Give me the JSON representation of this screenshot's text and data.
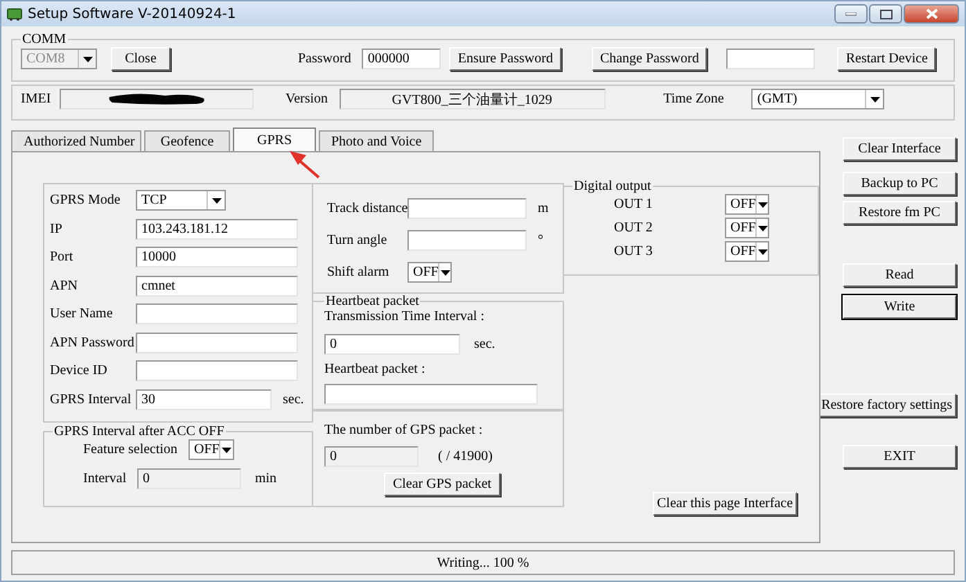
{
  "window": {
    "title": "Setup Software V-20140924-1"
  },
  "comm": {
    "title": "COMM",
    "port": {
      "value": "COM8",
      "disabled": true
    },
    "close": "Close",
    "password": {
      "label": "Password",
      "value": "000000"
    },
    "ensure": "Ensure Password",
    "change": "Change Password",
    "restart": "Restart Device"
  },
  "device": {
    "imei_label": "IMEI",
    "version_label": "Version",
    "version": "GVT800_三个油量计_1029",
    "timezone_label": "Time Zone",
    "timezone": "(GMT)"
  },
  "tabs": [
    {
      "label": "Authorized Number",
      "selected": false
    },
    {
      "label": "Geofence",
      "selected": false
    },
    {
      "label": "GPRS",
      "selected": true
    },
    {
      "label": "Photo and Voice",
      "selected": false
    }
  ],
  "gprs_fields": [
    {
      "label": "GPRS Mode",
      "kind": "combo",
      "value": "TCP"
    },
    {
      "label": "IP",
      "kind": "text",
      "value": "103.243.181.12"
    },
    {
      "label": "Port",
      "kind": "text",
      "value": "10000"
    },
    {
      "label": "APN",
      "kind": "text",
      "value": "cmnet"
    },
    {
      "label": "User Name",
      "kind": "text"
    },
    {
      "label": "APN Password",
      "kind": "text"
    },
    {
      "label": "Device ID",
      "kind": "text"
    },
    {
      "label": "GPRS Interval",
      "kind": "text",
      "value": "30",
      "unit": "sec."
    }
  ],
  "acc_off": {
    "title": "GPRS Interval after ACC OFF",
    "feature_label": "Feature selection",
    "feature_value": "OFF",
    "interval_label": "Interval",
    "interval_value": "0",
    "interval_disabled": true,
    "interval_unit": "min"
  },
  "track": [
    {
      "label": "Track distance",
      "kind": "text",
      "unit": "m"
    },
    {
      "label": "Turn angle",
      "kind": "text",
      "unit": "°"
    },
    {
      "label": "Shift alarm",
      "kind": "combo",
      "value": "OFF"
    }
  ],
  "heartbeat": {
    "title": "Heartbeat packet",
    "interval_label": "Transmission Time Interval :",
    "interval_value": "0",
    "interval_unit": "sec.",
    "packet_label": "Heartbeat packet :"
  },
  "gps_packet": {
    "label": "The number of GPS packet :",
    "value": "0",
    "disabled": true,
    "total": "( / 41900)",
    "button": "Clear GPS packet"
  },
  "digital_output": {
    "title": "Digital output",
    "outputs": [
      {
        "label": "OUT 1",
        "value": "OFF"
      },
      {
        "label": "OUT 2",
        "value": "OFF"
      },
      {
        "label": "OUT 3",
        "value": "OFF"
      }
    ]
  },
  "clear_page_button": "Clear this page Interface",
  "side_buttons": [
    {
      "label": "Clear Interface",
      "default": false
    },
    {
      "label": "Backup to PC",
      "default": false
    },
    {
      "label": "Restore fm PC",
      "default": false
    },
    {
      "label": "Read",
      "default": false
    },
    {
      "label": "Write",
      "default": true
    },
    {
      "label": "Restore factory settings",
      "default": false
    },
    {
      "label": "EXIT",
      "default": false
    }
  ],
  "status_bar": "Writing...  100 %"
}
